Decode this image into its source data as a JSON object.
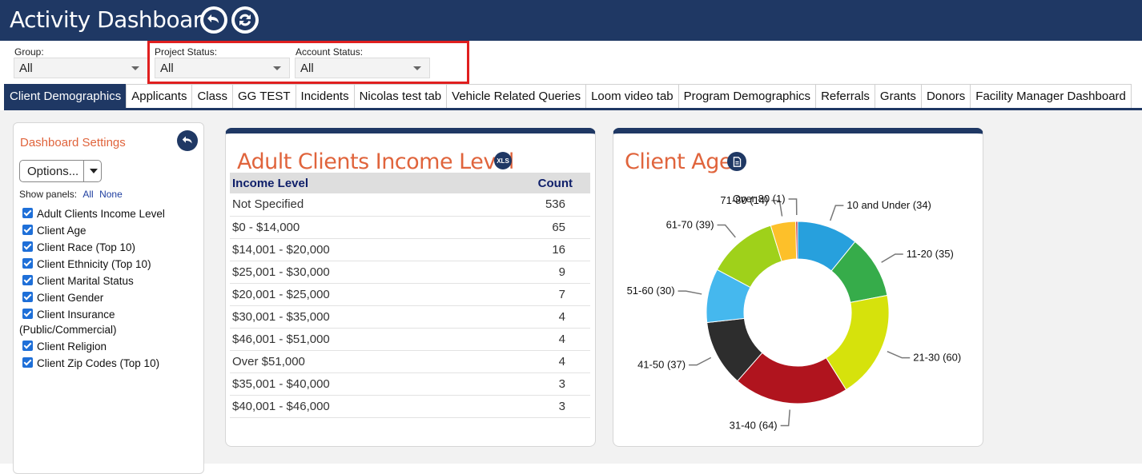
{
  "header": {
    "title": "Activity Dashboard",
    "back_icon": "undo-icon",
    "refresh_icon": "refresh-icon"
  },
  "filters": {
    "group": {
      "label": "Group:",
      "value": "All"
    },
    "project_status": {
      "label": "Project Status:",
      "value": "All"
    },
    "account_status": {
      "label": "Account Status:",
      "value": "All"
    }
  },
  "tabs": [
    {
      "label": "Client Demographics",
      "active": true
    },
    {
      "label": "Applicants"
    },
    {
      "label": "Class"
    },
    {
      "label": "GG TEST"
    },
    {
      "label": "Incidents"
    },
    {
      "label": "Nicolas test tab"
    },
    {
      "label": "Vehicle Related Queries"
    },
    {
      "label": "Loom video tab"
    },
    {
      "label": "Program Demographics"
    },
    {
      "label": "Referrals"
    },
    {
      "label": "Grants"
    },
    {
      "label": "Donors"
    },
    {
      "label": "Facility Manager Dashboard"
    }
  ],
  "sidebar": {
    "title": "Dashboard Settings",
    "options_label": "Options...",
    "show_panels_label": "Show panels:",
    "all_link": "All",
    "none_link": "None",
    "panels": [
      {
        "label": "Adult Clients Income Level",
        "checked": true
      },
      {
        "label": "Client Age",
        "checked": true
      },
      {
        "label": "Client Race (Top 10)",
        "checked": true
      },
      {
        "label": "Client Ethnicity (Top 10)",
        "checked": true
      },
      {
        "label": "Client Marital Status",
        "checked": true
      },
      {
        "label": "Client Gender",
        "checked": true
      },
      {
        "label": "Client Insurance (Public/Commercial)",
        "checked": true
      },
      {
        "label": "Client Religion",
        "checked": true
      },
      {
        "label": "Client Zip Codes (Top 10)",
        "checked": true
      }
    ]
  },
  "income_panel": {
    "title": "Adult Clients Income Level",
    "export_badge": "XLS",
    "col_income": "Income Level",
    "col_count": "Count",
    "rows": [
      {
        "level": "Not Specified",
        "count": "536"
      },
      {
        "level": "$0 - $14,000",
        "count": "65"
      },
      {
        "level": "$14,001 - $20,000",
        "count": "16"
      },
      {
        "level": "$25,001 - $30,000",
        "count": "9"
      },
      {
        "level": "$20,001 - $25,000",
        "count": "7"
      },
      {
        "level": "$30,001 - $35,000",
        "count": "4"
      },
      {
        "level": "$46,001 - $51,000",
        "count": "4"
      },
      {
        "level": "Over $51,000",
        "count": "4"
      },
      {
        "level": "$35,001 - $40,000",
        "count": "3"
      },
      {
        "level": "$40,001 - $46,000",
        "count": "3"
      }
    ]
  },
  "age_panel": {
    "title": "Client Age",
    "doc_icon": "document-icon"
  },
  "chart_data": {
    "type": "pie",
    "donut": true,
    "categories": [
      "10 and Under",
      "11-20",
      "21-30",
      "31-40",
      "41-50",
      "51-60",
      "61-70",
      "71-80",
      "Over 80"
    ],
    "values": [
      34,
      35,
      60,
      64,
      37,
      30,
      39,
      14,
      1
    ],
    "labels": [
      "10 and Under (34)",
      "11-20 (35)",
      "21-30 (60)",
      "31-40 (64)",
      "41-50 (37)",
      "51-60 (30)",
      "61-70 (39)",
      "71-80 (14)",
      "Over 80 (1)"
    ],
    "colors": [
      "#27a0dd",
      "#36ac4a",
      "#d6e20c",
      "#b0141e",
      "#2d2d2d",
      "#45b8ee",
      "#9fd11a",
      "#fdc02a",
      "#c0141e"
    ]
  }
}
